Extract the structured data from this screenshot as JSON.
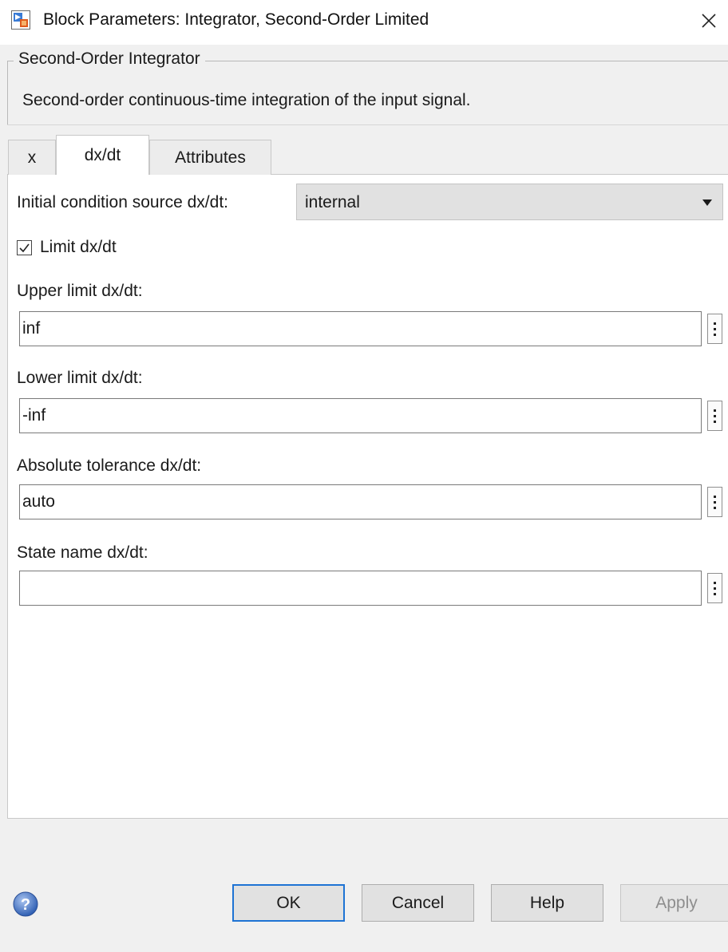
{
  "window": {
    "title": "Block Parameters: Integrator, Second-Order Limited",
    "close_icon": "close-icon",
    "app_icon": "simulink-block-icon"
  },
  "description": {
    "group_title": "Second-Order Integrator",
    "text": "Second-order continuous-time integration of the input signal."
  },
  "tabs": [
    {
      "label": "x",
      "active": false
    },
    {
      "label": "dx/dt",
      "active": true
    },
    {
      "label": "Attributes",
      "active": false
    }
  ],
  "parameters": {
    "ic_source": {
      "label": "Initial condition source dx/dt:",
      "value": "internal"
    },
    "limit": {
      "label": "Limit dx/dt",
      "checked": true
    },
    "upper_limit": {
      "label": "Upper limit dx/dt:",
      "value": "inf"
    },
    "lower_limit": {
      "label": "Lower limit dx/dt:",
      "value": "-inf"
    },
    "abs_tol": {
      "label": "Absolute tolerance dx/dt:",
      "value": "auto"
    },
    "state_name": {
      "label": "State name dx/dt:",
      "value": ""
    }
  },
  "buttons": {
    "ok": "OK",
    "cancel": "Cancel",
    "help": "Help",
    "apply": "Apply",
    "apply_enabled": false
  },
  "colors": {
    "accent": "#1e73d4",
    "help_icon": "#3b6fc4"
  }
}
